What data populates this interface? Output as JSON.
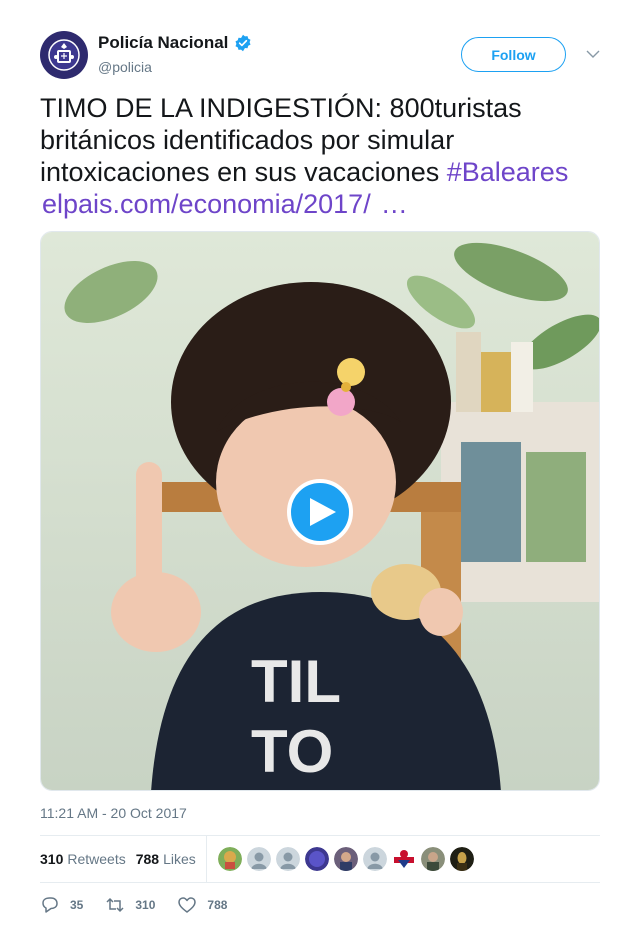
{
  "author": {
    "display_name": "Policía Nacional",
    "handle": "@policia",
    "verified": true,
    "avatar_icon": "police-badge-icon"
  },
  "follow_label": "Follow",
  "tweet": {
    "text_main": "TIMO DE LA INDIGESTIÓN: 800turistas británicos identificados por simular intoxicaciones en sus vacaciones ",
    "hashtag": "#Baleares",
    "link": "elpais.com/economia/2017/",
    "ellipsis": "…"
  },
  "media": {
    "kind": "video",
    "play_icon": "play-icon"
  },
  "timestamp": "11:21 AM - 20 Oct 2017",
  "stats": {
    "retweets_count": "310",
    "retweets_label": "Retweets",
    "likes_count": "788",
    "likes_label": "Likes"
  },
  "actions": {
    "replies": "35",
    "retweets": "310",
    "likes": "788"
  },
  "colors": {
    "link": "#6e45c9",
    "accent": "#1da1f2",
    "muted": "#657786"
  }
}
